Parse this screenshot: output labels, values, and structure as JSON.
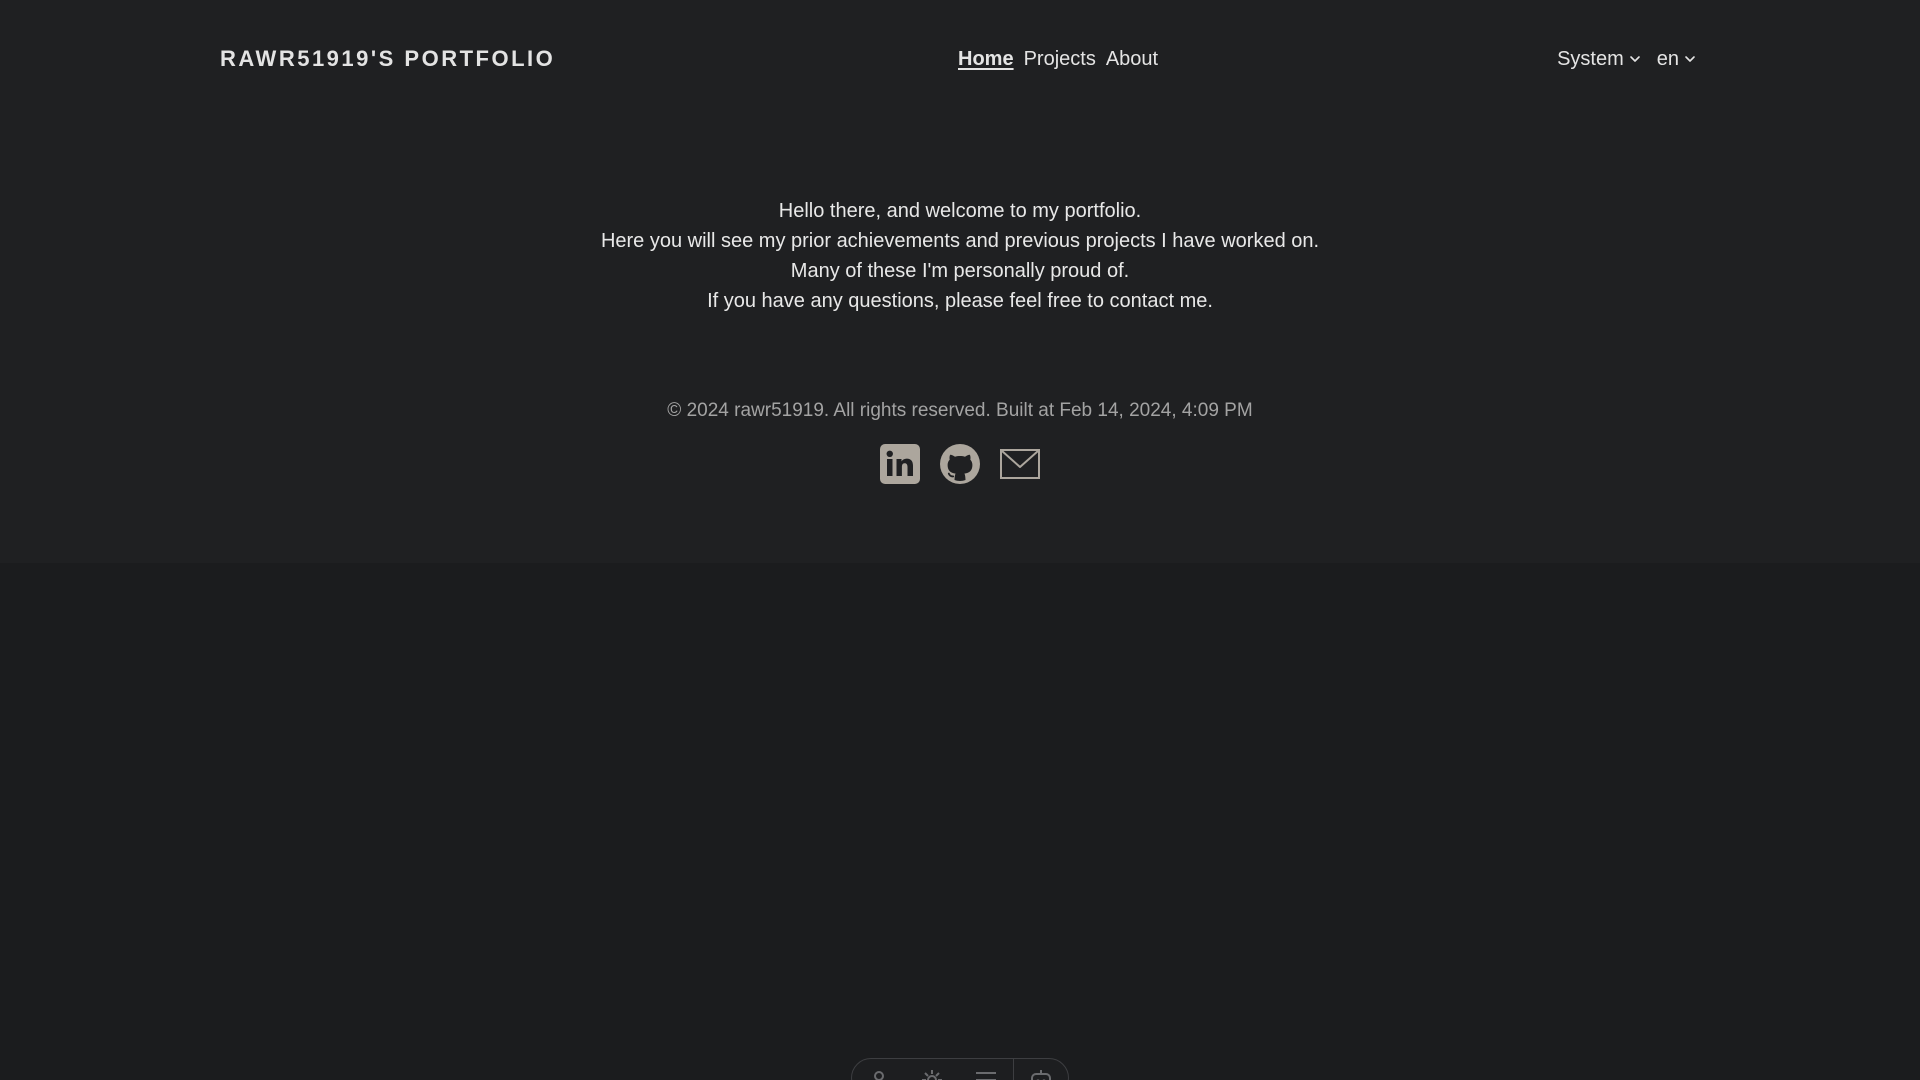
{
  "header": {
    "site_title": "RAWR51919'S PORTFOLIO",
    "nav": {
      "home": "Home",
      "projects": "Projects",
      "about": "About",
      "active": "Home"
    },
    "theme_select": "System",
    "language_select": "en"
  },
  "main": {
    "welcome_lines": [
      "Hello there, and welcome to my portfolio.",
      "Here you will see my prior achievements and previous projects I have worked on.",
      "Many of these I'm personally proud of.",
      "If you have any questions, please feel free to contact me."
    ]
  },
  "footer": {
    "copyright": "© 2024 rawr51919. All rights reserved. Built at Feb 14, 2024, 4:09 PM",
    "social_icons": [
      "linkedin-icon",
      "github-icon",
      "mail-icon"
    ]
  },
  "dock": {
    "icons": [
      "person-icon",
      "settings-icon",
      "menu-icon",
      "robot-icon"
    ]
  },
  "colors": {
    "background": "#1f2022",
    "text": "#e4e4e4",
    "muted_text": "#a3a3a3",
    "icon": "#aca69d"
  }
}
